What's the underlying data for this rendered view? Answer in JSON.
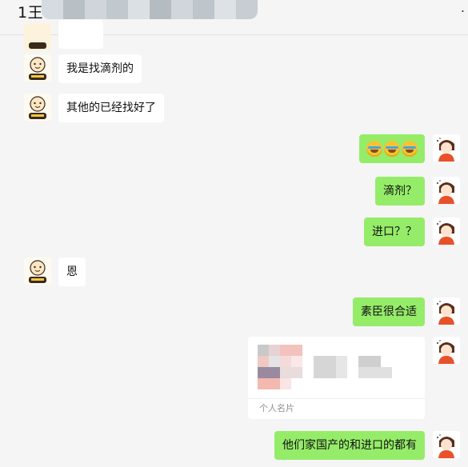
{
  "header": {
    "title": "1王",
    "more": "."
  },
  "messages": [
    {
      "side": "left",
      "text": "我是找滴剂的"
    },
    {
      "side": "left",
      "text": "其他的已经找好了"
    },
    {
      "side": "right",
      "emoji": [
        "crying-laughing-emoji",
        "crying-laughing-emoji",
        "crying-laughing-emoji"
      ]
    },
    {
      "side": "right",
      "text": "滴剂？"
    },
    {
      "side": "right",
      "text": "进口？？"
    },
    {
      "side": "left",
      "text": "恩"
    },
    {
      "side": "right",
      "text": "素臣很合适"
    },
    {
      "side": "right",
      "card": {
        "label": "个人名片"
      }
    },
    {
      "side": "right",
      "text": "他们家国产的和进口的都有"
    }
  ],
  "colors": {
    "background": "#f5f5f5",
    "incoming_bubble": "#ffffff",
    "outgoing_bubble": "#95ec69"
  }
}
